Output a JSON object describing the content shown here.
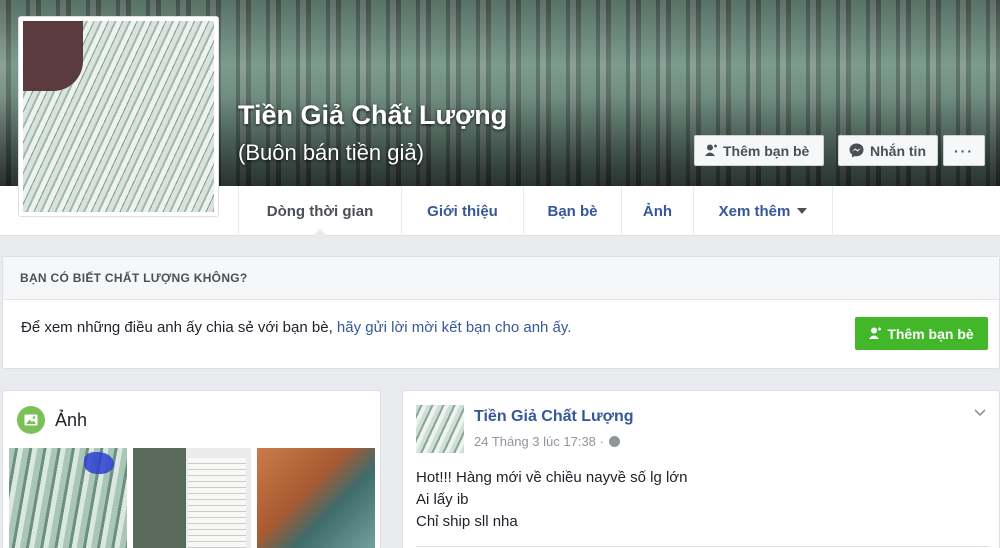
{
  "profile": {
    "name": "Tiền Giả Chất Lượng",
    "subtitle": "(Buôn bán tiền giả)"
  },
  "cover_buttons": {
    "add_friend": "Thêm bạn bè",
    "message": "Nhắn tin",
    "more": "···"
  },
  "tabs": [
    {
      "label": "Dòng thời gian"
    },
    {
      "label": "Giới thiệu"
    },
    {
      "label": "Bạn bè"
    },
    {
      "label": "Ảnh"
    },
    {
      "label": "Xem thêm"
    }
  ],
  "know_card": {
    "heading": "BẠN CÓ BIẾT CHẤT LƯỢNG KHÔNG?",
    "text": "Để xem những điều anh ấy chia sẻ với bạn bè, ",
    "link": "hãy gửi lời mời kết bạn cho anh ấy.",
    "button": "Thêm bạn bè"
  },
  "photos": {
    "heading": "Ảnh"
  },
  "post": {
    "author": "Tiền Giả Chất Lượng",
    "time": "24 Tháng 3 lúc 17:38 ·",
    "lines": [
      "Hot!!! Hàng mới về chiều nayvề số lg lớn",
      "Ai lấy ib",
      "Chỉ ship sll nha"
    ]
  },
  "colors": {
    "link": "#365899",
    "green": "#42b72a",
    "background": "#e9ebee"
  }
}
